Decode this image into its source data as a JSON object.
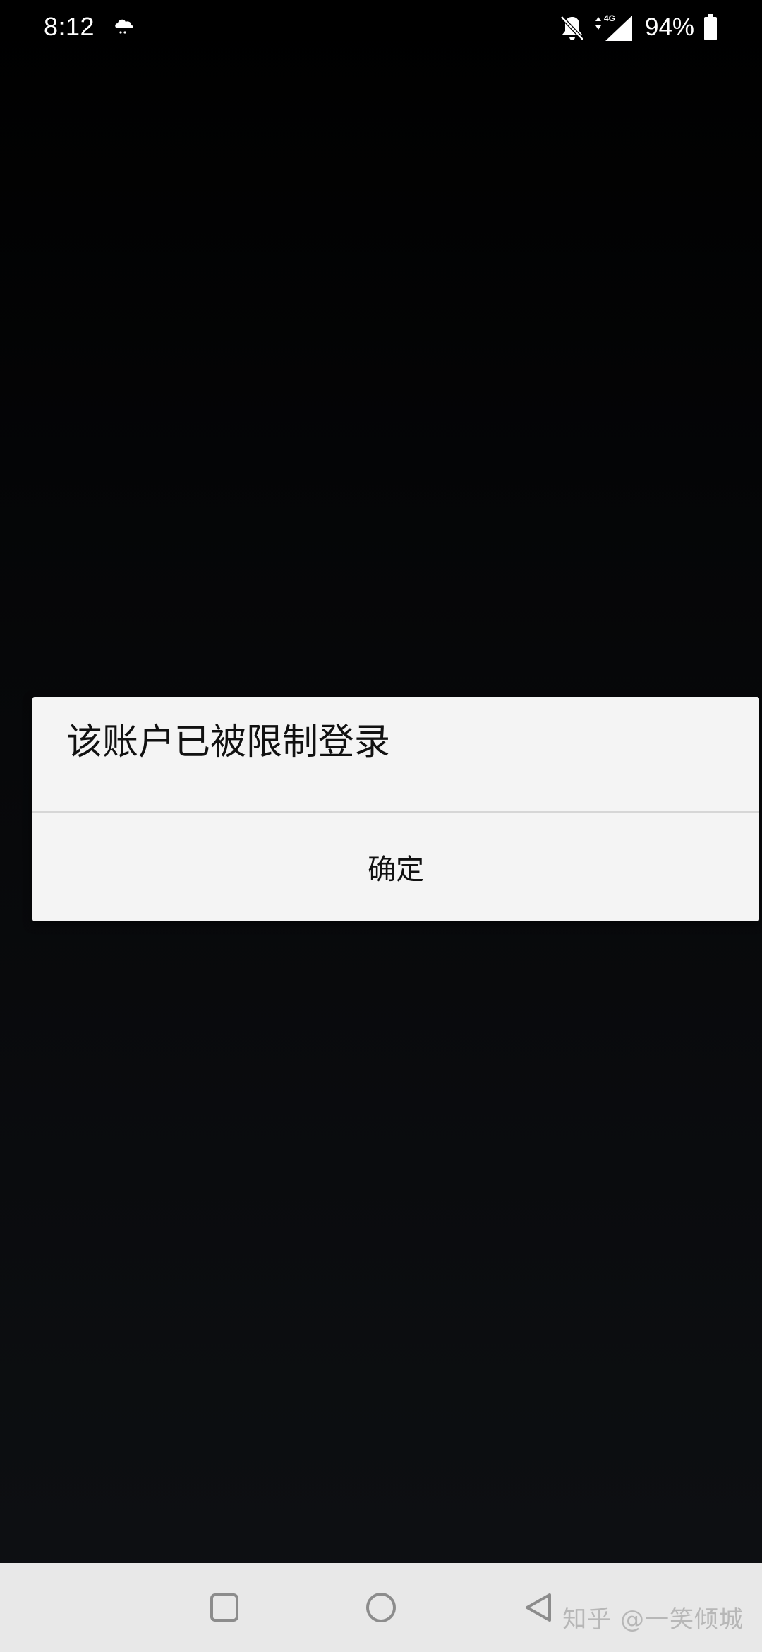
{
  "status_bar": {
    "time": "8:12",
    "weather_icon": "cloud-rain-icon",
    "notifications_icon": "bell-off-icon",
    "network_label": "4G",
    "signal_icon": "cell-signal-icon",
    "battery_percent": "94%",
    "battery_icon": "battery-icon"
  },
  "dialog": {
    "message": "该账户已被限制登录",
    "confirm_label": "确定"
  },
  "nav_bar": {
    "recent_icon": "square-recents-icon",
    "home_icon": "circle-home-icon",
    "back_icon": "triangle-back-icon"
  },
  "watermark": {
    "text": "知乎 @一笑倾城"
  },
  "colors": {
    "dialog_background": "#f4f4f4",
    "nav_background": "#e8e8e8",
    "screen_background": "#000000"
  }
}
